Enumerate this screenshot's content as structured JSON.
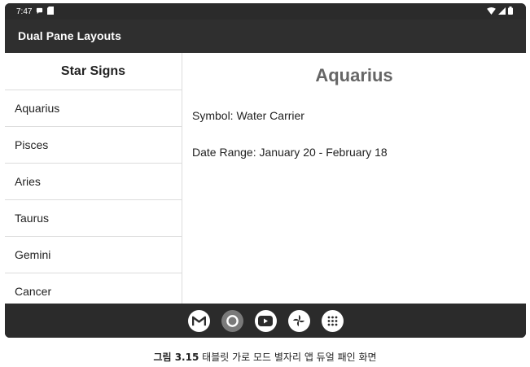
{
  "status_bar": {
    "time": "7:47",
    "left_icons": [
      "notification-icon",
      "sd-card-icon"
    ],
    "right_icons": [
      "wifi-icon",
      "signal-icon",
      "battery-icon"
    ]
  },
  "app_bar": {
    "title": "Dual Pane Layouts"
  },
  "list_pane": {
    "header": "Star Signs",
    "items": [
      {
        "label": "Aquarius"
      },
      {
        "label": "Pisces"
      },
      {
        "label": "Aries"
      },
      {
        "label": "Taurus"
      },
      {
        "label": "Gemini"
      },
      {
        "label": "Cancer"
      }
    ]
  },
  "detail_pane": {
    "title": "Aquarius",
    "symbol": "Symbol: Water Carrier",
    "date_range": "Date Range: January 20 - February 18"
  },
  "dock": {
    "apps": [
      "gmail-icon",
      "chrome-icon",
      "youtube-icon",
      "photos-icon",
      "app-drawer-icon"
    ]
  },
  "caption": {
    "label": "그림 3.15",
    "text": "태블릿 가로 모드 별자리 앱 듀얼 패인 화면"
  },
  "colors": {
    "app_bar_bg": "#2f2f2f",
    "device_bg": "#2b2b2b",
    "detail_title": "#666666",
    "divider": "#dcdcdc"
  }
}
